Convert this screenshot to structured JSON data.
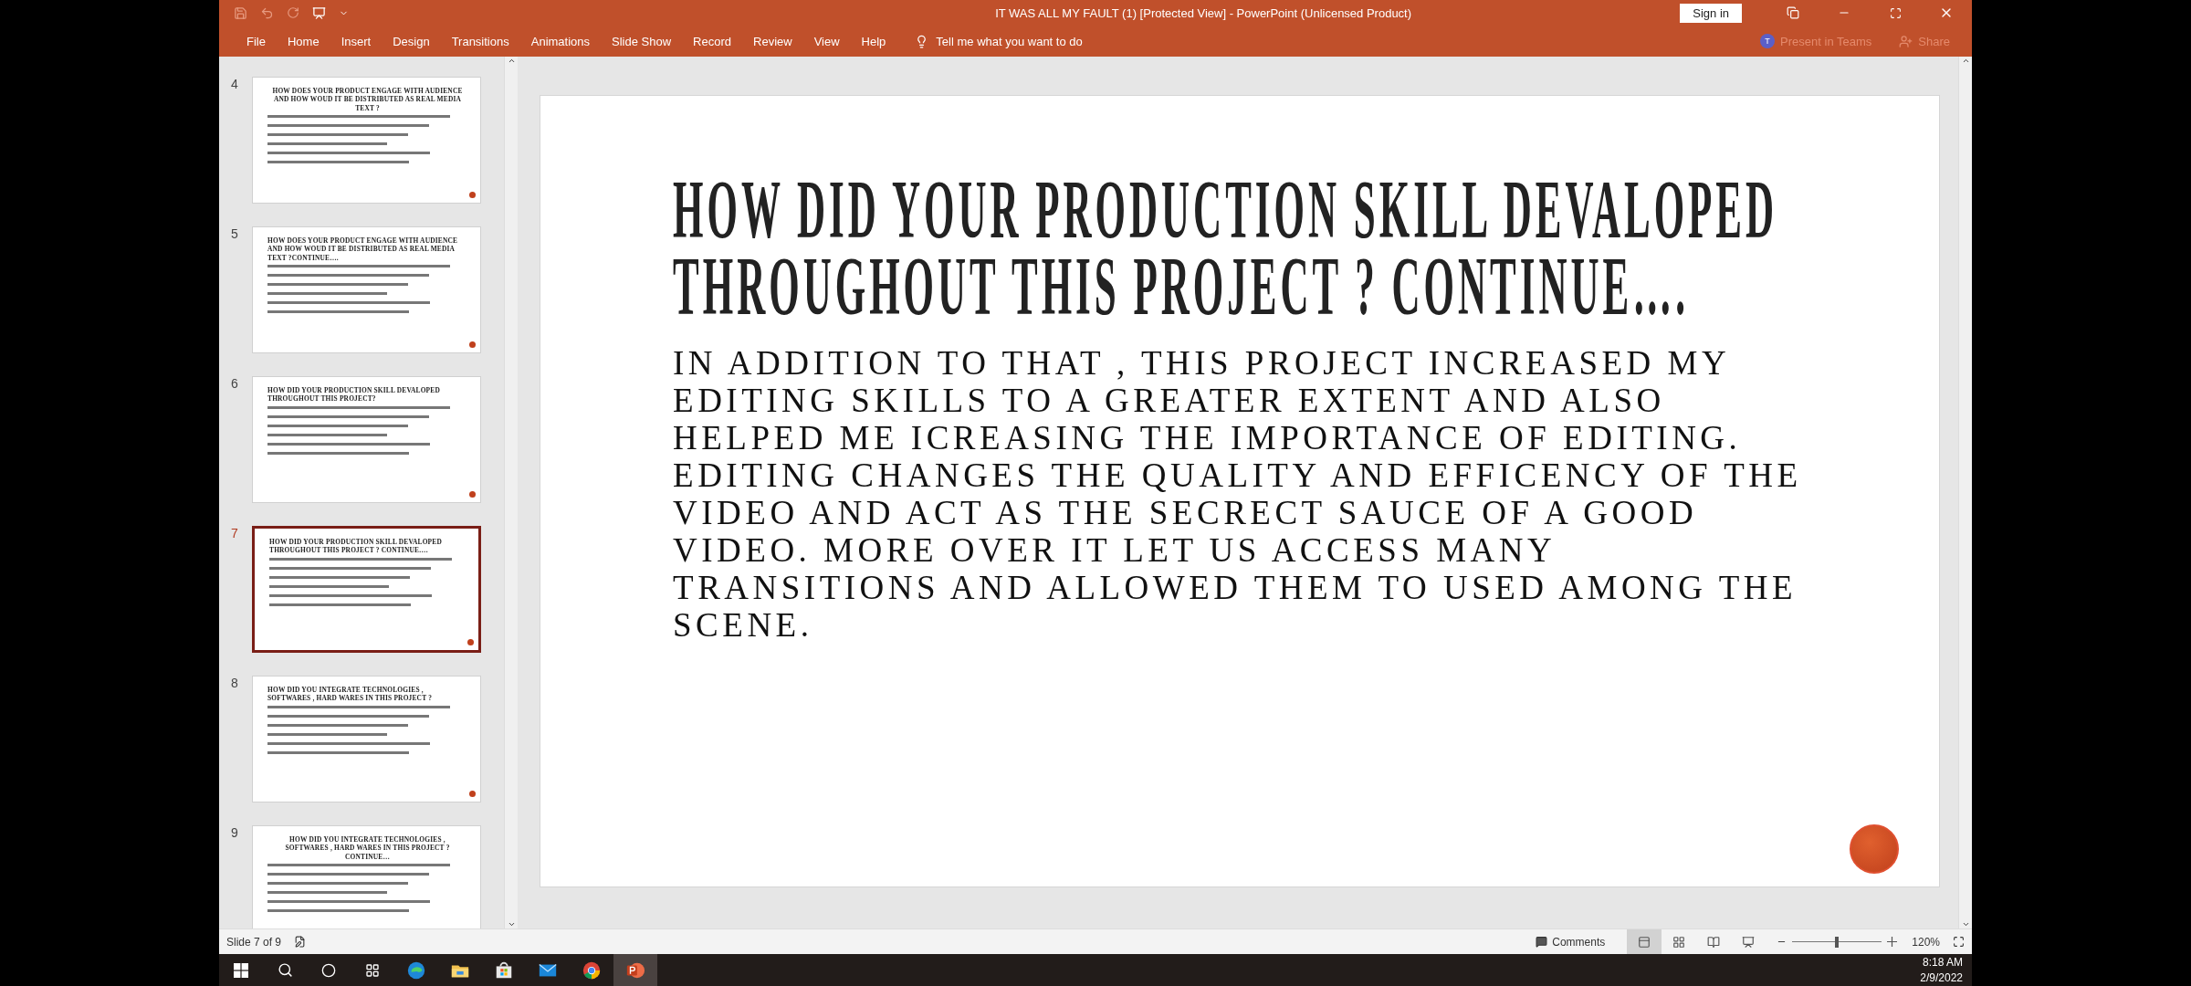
{
  "title_bar": {
    "title": "IT WAS ALL MY FAULT (1) [Protected View]  -  PowerPoint (Unlicensed Product)",
    "sign_in": "Sign in"
  },
  "ribbon_tabs": [
    {
      "label": "File"
    },
    {
      "label": "Home"
    },
    {
      "label": "Insert"
    },
    {
      "label": "Design"
    },
    {
      "label": "Transitions"
    },
    {
      "label": "Animations"
    },
    {
      "label": "Slide Show"
    },
    {
      "label": "Record"
    },
    {
      "label": "Review"
    },
    {
      "label": "View"
    },
    {
      "label": "Help"
    }
  ],
  "tell_me": "Tell me what you want to do",
  "teams": {
    "badge": "T",
    "label": "Present in Teams",
    "disabled": true
  },
  "share": {
    "label": "Share",
    "disabled": true
  },
  "thumbnails": [
    {
      "number": "4",
      "title": "HOW DOES YOUR PRODUCT ENGAGE WITH AUDIENCE AND HOW WOUD IT BE DISTRIBUTED AS REAL MEDIA TEXT ?",
      "centered": true,
      "selected": false
    },
    {
      "number": "5",
      "title": "HOW DOES YOUR PRODUCT ENGAGE WITH AUDIENCE AND HOW WOUD IT BE DISTRIBUTED AS REAL MEDIA TEXT ?CONTINUE….",
      "centered": false,
      "selected": false
    },
    {
      "number": "6",
      "title": "HOW DID YOUR PRODUCTION SKILL DEVALOPED THROUGHOUT THIS PROJECT?",
      "centered": false,
      "selected": false
    },
    {
      "number": "7",
      "title": "HOW DID YOUR PRODUCTION SKILL DEVALOPED THROUGHOUT THIS PROJECT ? CONTINUE….",
      "centered": false,
      "selected": true
    },
    {
      "number": "8",
      "title": "HOW DID YOU INTEGRATE TECHNOLOGIES , SOFTWARES , HARD WARES IN THIS PROJECT ?",
      "centered": false,
      "selected": false
    },
    {
      "number": "9",
      "title": "HOW DID YOU INTEGRATE TECHNOLOGIES , SOFTWARES , HARD WARES IN THIS PROJECT ?CONTINUE…",
      "centered": true,
      "selected": false
    }
  ],
  "slide": {
    "title": "HOW DID YOUR PRODUCTION SKILL DEVALOPED THROUGHOUT THIS PROJECT ? CONTINUE….",
    "body": "IN ADDITION TO THAT , THIS PROJECT INCREASED MY EDITING SKILLS TO A GREATER EXTENT AND ALSO HELPED ME ICREASING THE IMPORTANCE OF EDITING. EDITING CHANGES THE QUALITY AND EFFICENCY OF THE VIDEO AND ACT AS THE SECRECT SAUCE OF A GOOD VIDEO. MORE OVER IT LET US ACCESS MANY TRANSITIONS AND ALLOWED THEM TO USED AMONG THE SCENE."
  },
  "status_bar": {
    "slide_counter": "Slide 7 of 9",
    "comments": "Comments",
    "views": [
      {
        "kind": "normal",
        "selected": true
      },
      {
        "kind": "sorter",
        "selected": false
      },
      {
        "kind": "reading",
        "selected": false
      },
      {
        "kind": "slideshow",
        "selected": false
      }
    ],
    "zoom": {
      "level": 0.5,
      "reading": "120%"
    }
  },
  "taskbar": {
    "apps": [
      {
        "kind": "edge",
        "active": false
      },
      {
        "kind": "explorer",
        "active": false
      },
      {
        "kind": "store",
        "active": false
      },
      {
        "kind": "mail",
        "active": false
      },
      {
        "kind": "chrome",
        "active": false
      },
      {
        "kind": "powerpoint",
        "active": true
      }
    ],
    "time": "8:18 AM",
    "date": "2/9/2022"
  }
}
